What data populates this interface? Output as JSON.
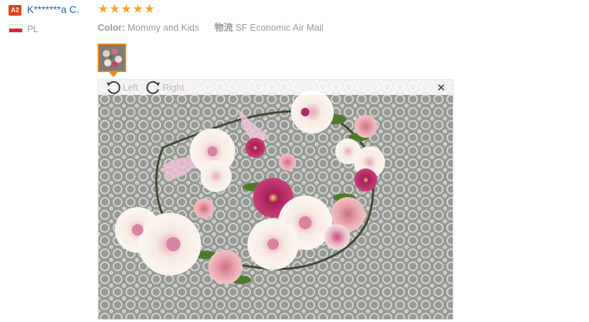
{
  "reviewer": {
    "badge": "A2",
    "name": "K*******a C.",
    "country": "PL",
    "flag_colors": [
      "#ffffff",
      "#d8263a"
    ]
  },
  "review": {
    "rating": 5,
    "star_glyph": "★",
    "star_color": "#f5a623",
    "color_label": "Color:",
    "color_value": "Mommy and Kids",
    "shipping_label": "物流",
    "shipping_value": "SF Economic Air Mail"
  },
  "viewer": {
    "rotate_left_label": "Left",
    "rotate_right_label": "Right",
    "close_glyph": "✕",
    "photo_subject": "flower crown with pink and cream roses on white lace tablecloth"
  },
  "colors": {
    "accent": "#f3851b",
    "badge": "#e0421b",
    "link": "#1a5fb4"
  }
}
